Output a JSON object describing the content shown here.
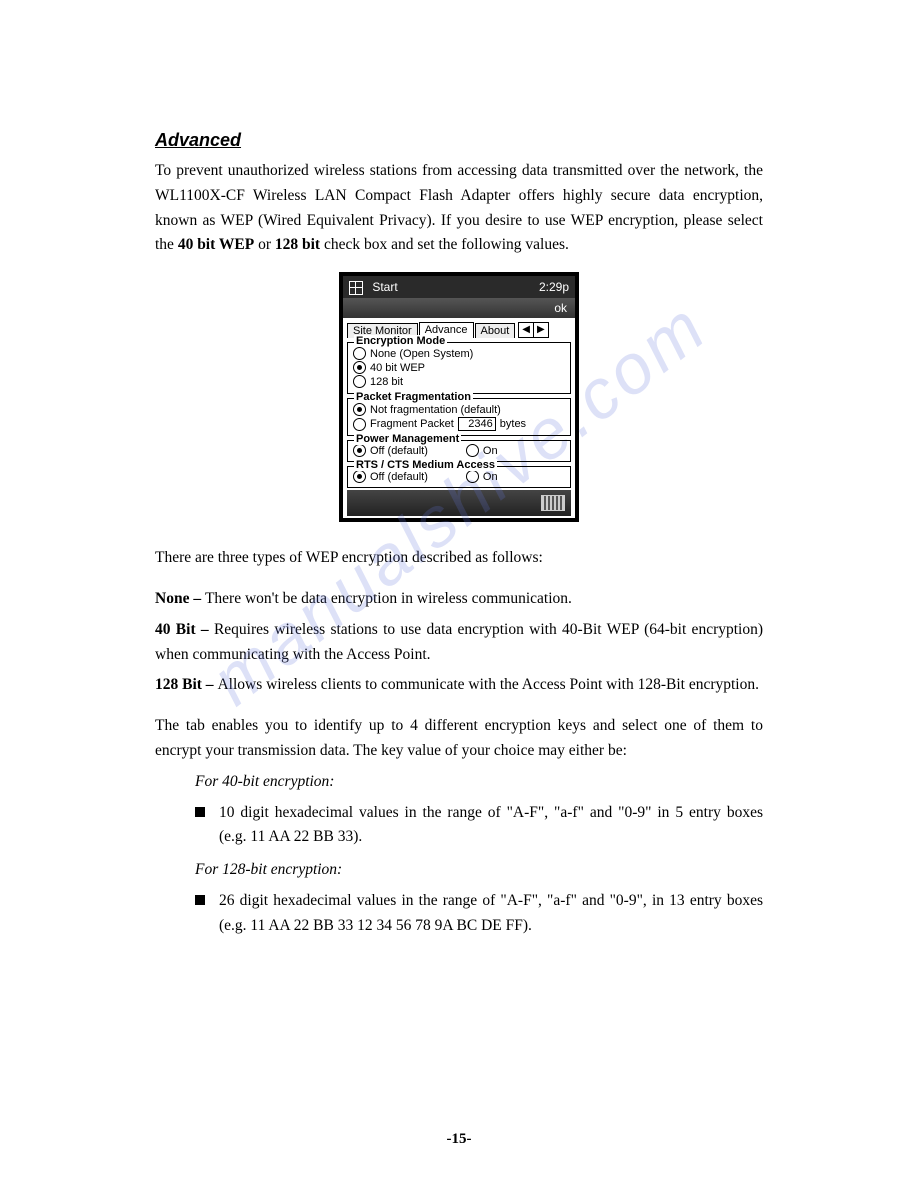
{
  "watermark": "manualshive.com",
  "title": "Advanced",
  "intro": "To prevent unauthorized wireless stations from accessing data transmitted over the network, the WL1100X-CF Wireless LAN Compact Flash Adapter offers highly secure data encryption, known as WEP (Wired Equivalent Privacy).   If you desire to use WEP encryption, please select the ",
  "intro_bold1": "40 bit WEP",
  "intro_mid": " or ",
  "intro_bold2": "128 bit",
  "intro_end": " check box and set the following values.",
  "pda": {
    "title_left": "Start",
    "title_right": "2:29p",
    "ok": "ok",
    "tabs": {
      "site": "Site Monitor",
      "advance": "Advance",
      "about": "About"
    },
    "enc": {
      "legend": "Encryption Mode",
      "none": "None (Open System)",
      "wep40": "40 bit WEP",
      "bit128": "128 bit"
    },
    "frag": {
      "legend": "Packet Fragmentation",
      "default": "Not fragmentation (default)",
      "frag_label": "Fragment Packet",
      "value": "2346",
      "unit": "bytes"
    },
    "power": {
      "legend": "Power Management",
      "off": "Off (default)",
      "on": "On"
    },
    "rts": {
      "legend": "RTS / CTS Medium Access",
      "off": "Off (default)",
      "on": "On"
    }
  },
  "after1": "There are three types of WEP encryption described as follows:",
  "none_label": "None – ",
  "none_text": "There won't be data encryption in wireless communication.",
  "b40_label": "40 Bit – ",
  "b40_text": "Requires wireless stations to use data encryption with 40-Bit WEP (64-bit encryption) when communicating with the Access Point.",
  "b128_label": "128 Bit – ",
  "b128_text": "Allows wireless clients to communicate with the Access Point with 128-Bit encryption.",
  "tabpara": "The tab enables you to identify up to 4 different encryption keys and select one of them to encrypt your transmission data.   The key value of your choice may either be:",
  "for40": "For 40-bit encryption:",
  "for40_bullet": "10 digit hexadecimal values in the range of \"A-F\", \"a-f\" and \"0-9\" in 5 entry boxes (e.g. 11 AA 22 BB 33).",
  "for128": "For 128-bit encryption:",
  "for128_bullet": "26 digit hexadecimal values in the range of \"A-F\", \"a-f\" and \"0-9\", in 13 entry boxes (e.g. 11 AA 22 BB 33 12 34 56 78 9A BC DE FF).",
  "page_number": "-15-"
}
